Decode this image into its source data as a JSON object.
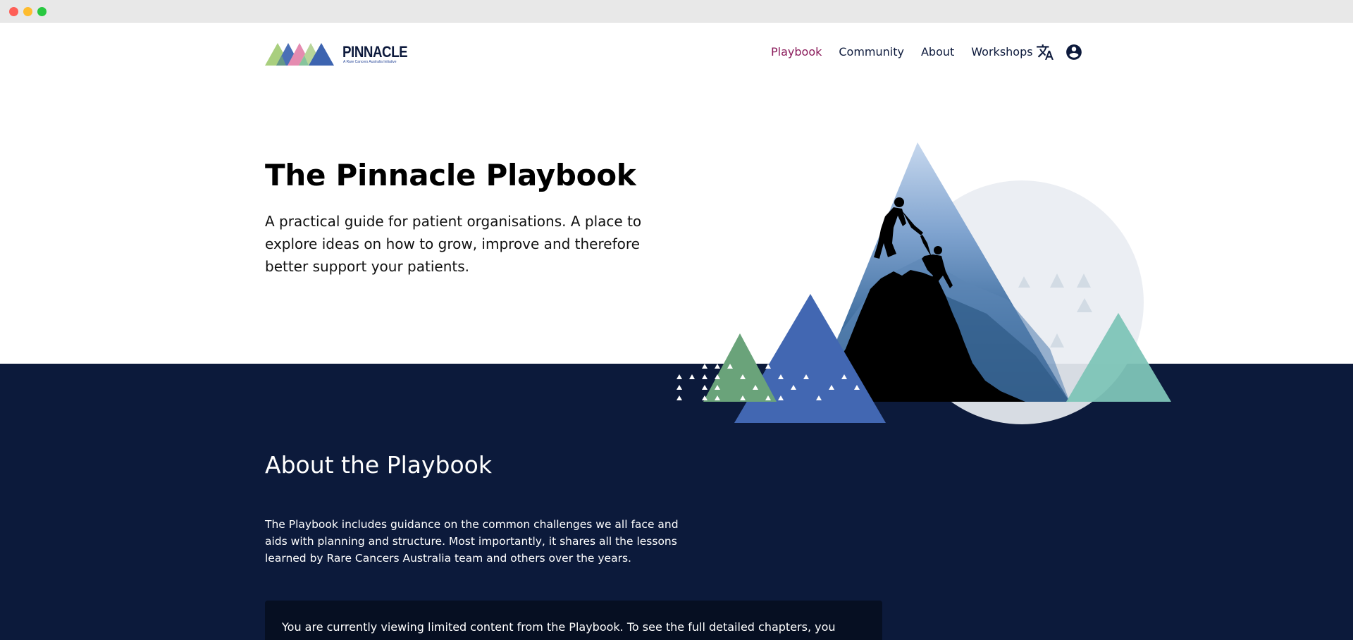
{
  "header": {
    "logo": {
      "name": "PINNACLE",
      "tagline": "A Rare Cancers Australia Initiative",
      "colors": [
        "#a9cf7e",
        "#4a6fb6",
        "#e58bb0",
        "#7bbf9e",
        "#3d64b0"
      ]
    },
    "nav": [
      {
        "label": "Playbook",
        "active": true
      },
      {
        "label": "Community",
        "active": false
      },
      {
        "label": "About",
        "active": false
      },
      {
        "label": "Workshops",
        "active": false
      }
    ],
    "icons": {
      "translate": "translate-icon",
      "account": "account-circle-icon"
    }
  },
  "hero": {
    "title": "The Pinnacle Playbook",
    "description": "A practical guide for patient organisations. A place to explore ideas on how to grow, improve and therefore better support your patients."
  },
  "about": {
    "title": "About the Playbook",
    "description": "The Playbook includes guidance on the common challenges we all face and aids with planning and structure. Most importantly, it shares all the lessons learned by Rare Cancers Australia team and others over the years.",
    "notice": "You are currently viewing limited content from the Playbook. To see the full detailed chapters, you must sign up to become a member and access the playbook."
  },
  "colors": {
    "navy": "#0c1a3b",
    "notice_bg": "#060f22",
    "active_nav": "#8a1a5a",
    "blue_triangle": "#4267b2",
    "green_triangle": "#6aa37a",
    "teal_triangle": "#7ec4b7",
    "circle": "#e9edf2"
  }
}
